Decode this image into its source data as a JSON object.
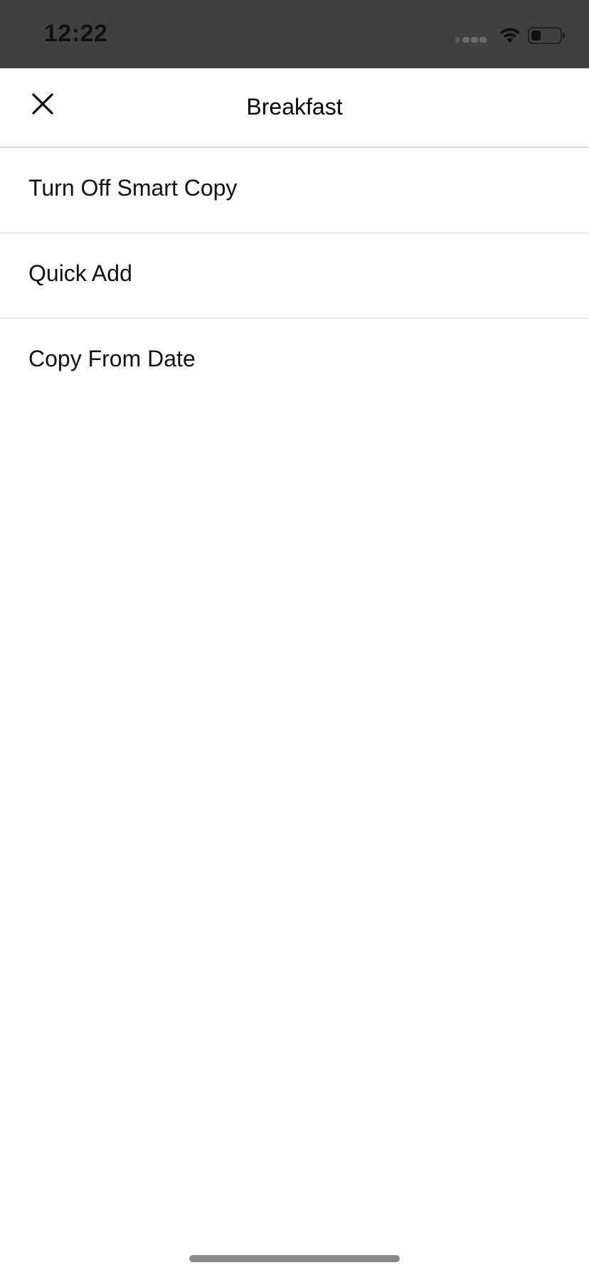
{
  "status_bar": {
    "time": "12:22",
    "battery_level": 0.35
  },
  "header": {
    "title": "Breakfast",
    "close_icon": "close-icon"
  },
  "menu": {
    "items": [
      {
        "label": "Turn Off Smart Copy"
      },
      {
        "label": "Quick Add"
      },
      {
        "label": "Copy From Date"
      }
    ]
  },
  "colors": {
    "status_bar_bg": "#414141",
    "divider": "#dcdcdc",
    "text": "#111111"
  }
}
